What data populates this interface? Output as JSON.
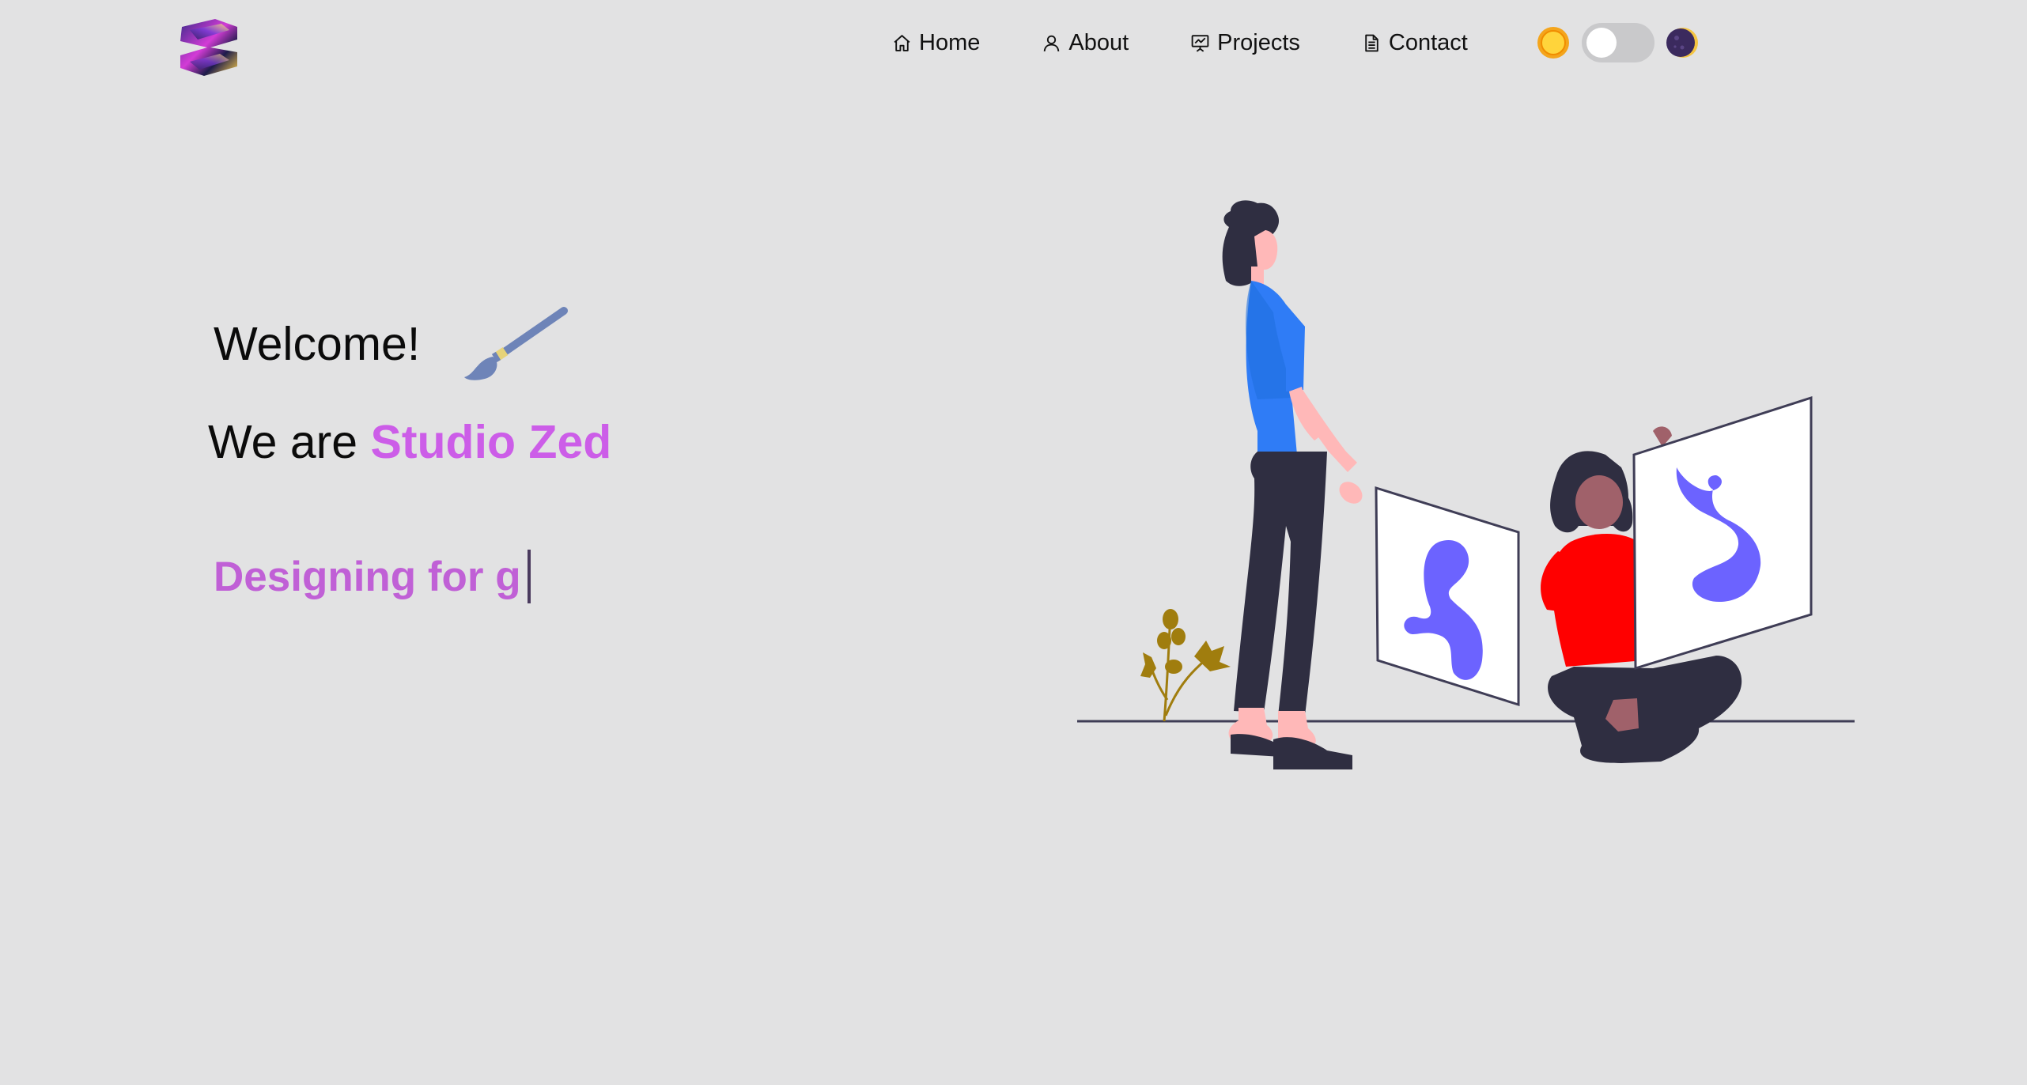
{
  "nav": {
    "logo": "zed-logo",
    "items": [
      {
        "label": "Home",
        "icon": "home-icon"
      },
      {
        "label": "About",
        "icon": "user-icon"
      },
      {
        "label": "Projects",
        "icon": "presentation-icon"
      },
      {
        "label": "Contact",
        "icon": "document-icon"
      }
    ],
    "theme": {
      "light_icon": "sun-icon",
      "dark_icon": "moon-icon",
      "mode": "light"
    }
  },
  "hero": {
    "welcome": "Welcome!",
    "welcome_icon": "paintbrush-icon",
    "we_are": "We are ",
    "brand": "Studio Zed",
    "typing_text": "Designing for g"
  },
  "colors": {
    "background": "#e2e2e3",
    "accent": "#cc5de8",
    "illustration_blue": "#2f7cf6",
    "illustration_red": "#ff0000",
    "illustration_purple": "#6c63ff"
  }
}
